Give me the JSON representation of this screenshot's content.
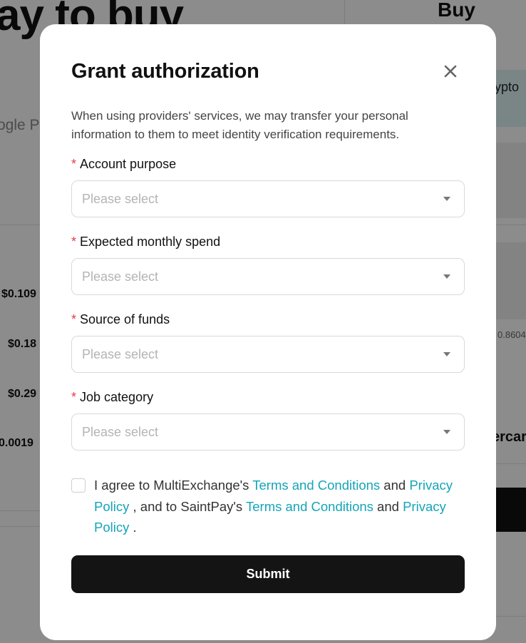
{
  "background": {
    "left_heading": "ay to buy",
    "left_subtext": "ogle P",
    "prices": [
      "$0.109",
      "$0.18",
      "$0.29",
      "0.0019"
    ],
    "right_heading": "Buy",
    "right_banner_text": "rypto",
    "right_rate": "0.8604",
    "right_provider_name": "ercar"
  },
  "modal": {
    "title": "Grant authorization",
    "description": "When using providers' services, we may transfer your personal information to them to meet identity verification requirements.",
    "required_mark": "*",
    "fields": [
      {
        "label": "Account purpose",
        "placeholder": "Please select"
      },
      {
        "label": "Expected monthly spend",
        "placeholder": "Please select"
      },
      {
        "label": "Source of funds",
        "placeholder": "Please select"
      },
      {
        "label": "Job category",
        "placeholder": "Please select"
      }
    ],
    "agreement": {
      "checked": false,
      "part1": "I agree to MultiExchange's ",
      "terms_link_1": "Terms and Conditions",
      "and_1": " and ",
      "privacy_link_1": "Privacy Policy",
      "part2": " , and to SaintPay's ",
      "terms_link_2": "Terms and Conditions",
      "and_2": " and ",
      "privacy_link_2": "Privacy Policy",
      "part3": " ."
    },
    "submit_label": "Submit"
  },
  "colors": {
    "required": "#e83a46",
    "link": "#14a4b8",
    "primary_button": "#141414",
    "overlay": "rgba(0,0,0,0.45)"
  },
  "icons": {
    "close": "close-icon",
    "select_caret": "caret-down-icon"
  }
}
